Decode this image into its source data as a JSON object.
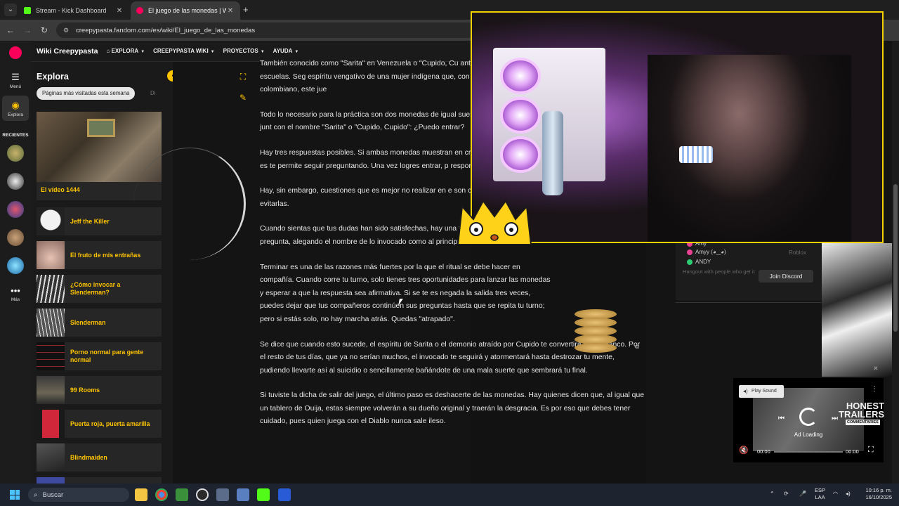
{
  "browser": {
    "tabs": [
      {
        "title": "Stream - Kick Dashboard",
        "favicon": "kick-icon"
      },
      {
        "title": "El juego de las monedas | Wiki",
        "favicon": "fandom-icon"
      }
    ],
    "url": "creepypasta.fandom.com/es/wiki/El_juego_de_las_monedas"
  },
  "rail": {
    "menu_label": "Menú",
    "explore_label": "Explora",
    "recent_label": "RECIENTES",
    "more_label": "Más"
  },
  "wiki": {
    "name": "Wiki Creepypasta",
    "nav": [
      {
        "label": "EXPLORA"
      },
      {
        "label": "CREEPYPASTA WIKI"
      },
      {
        "label": "PROYECTOS"
      },
      {
        "label": "AYUDA"
      }
    ]
  },
  "explore": {
    "title": "Explora",
    "chip": "Páginas más visitadas esta semana",
    "chip2": "Di",
    "featured": "El vídeo 1444",
    "items": [
      {
        "label": "Jeff the Killer"
      },
      {
        "label": "El fruto de mis entrañas"
      },
      {
        "label": "¿Cómo invocar a Slenderman?"
      },
      {
        "label": "Slenderman"
      },
      {
        "label": "Porno normal para gente normal"
      },
      {
        "label": "99 Rooms"
      },
      {
        "label": "Puerta roja, puerta amarilla"
      },
      {
        "label": "Blindmaiden"
      }
    ]
  },
  "article": {
    "paragraphs": [
      "También conocido como \"Sarita\" en Venezuela o \"Cupido, Cu antiguo que, hoy en día, ha ganado auge en las escuelas. Seg espíritu vengativo de una mujer indígena que, con ayuda del juegas con ella. Según el punto de vista colombiano, este jue",
      "Todo lo necesario para la práctica son dos monedas de igual suele jugar en compañía. Ambas monedas son lanzadas junt con el nombre \"Sarita\" o \"Cupido, Cupido\": ¿Puedo entrar?",
      "Hay tres respuestas posibles. Si ambas monedas muestran en cruz, es un \"Tal vez\". Si ambas monedas marcan cruz, es te permite seguir preguntando. Una vez logres entrar, p responda con aquellas tres opciones, como \"¿Pasaré el ex",
      "Hay, sin embargo, cuestiones que es mejor no realizar en e son consideradas riesgosas, por lo que es recomendado evitarlas.",
      "Cuando sientas que tus dudas han sido satisfechas, hay una forma de terminar el juego. Debes hacer una última pregunta, alegando el nombre de lo invocado como al principio: \"¿Puedo salir?\"",
      "Terminar es una de las razones más fuertes por la que el ritual se debe hacer en compañía. Cuando corre tu turno, solo tienes tres oportunidades para lanzar las monedas y esperar a que la respuesta sea afirmativa. Si se te es negada la salida tres veces, puedes dejar que tus compañeros continúen sus preguntas hasta que se repita tu turno; pero si estás solo, no hay marcha atrás. Quedas \"atrapado\".",
      "Se dice que cuando esto sucede, el espíritu de Sarita o el demonio atraído por Cupido te convertirá en su blanco. Por el resto de tus días, que ya no serían muchos, el invocado te seguirá y atormentará hasta destrozar tu mente, pudiendo llevarte así al suicidio o sencillamente bañándote de una mala suerte que sembrará tu final.",
      "Si tuviste la dicha de salir del juego, el último paso es deshacerte de las monedas. Hay quienes dicen que, al igual que un tablero de Ouija, estas siempre volverán a su dueño original y traerán la desgracia. Es por eso que debes tener cuidado, pues quien juega con el Diablo nunca sale ileso."
    ]
  },
  "discord": {
    "users": [
      {
        "name": "Amy",
        "color": "#e84393"
      },
      {
        "name": "Amyy (◕‿◕)",
        "color": "#e84393",
        "game": "Roblox"
      },
      {
        "name": "ANDY",
        "color": "#2ecc71"
      }
    ],
    "hangout": "Hangout with people who get it",
    "join": "Join Discord"
  },
  "ad": {
    "play_sound": "Play Sound",
    "brand_line1": "HONEST",
    "brand_line2": "TRAILERS",
    "brand_line3": "COMMENTARIES",
    "loading": "Ad Loading",
    "time_start": "00:00",
    "time_end": "00:00"
  },
  "taskbar": {
    "search_placeholder": "Buscar",
    "lang1": "ESP",
    "lang2": "LAA",
    "time": "10:16 p. m.",
    "date": "16/10/2025"
  },
  "colors": {
    "accent": "#ffc500",
    "brand": "#fa005a",
    "overlay_border": "#f2d100"
  }
}
